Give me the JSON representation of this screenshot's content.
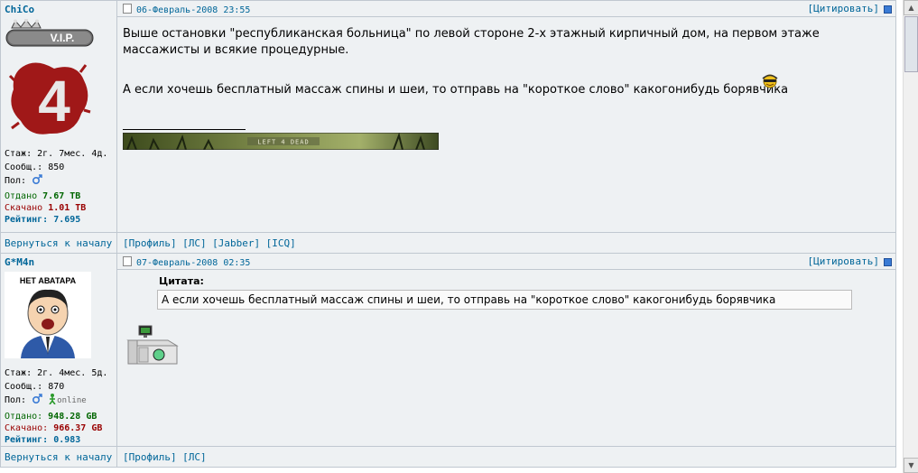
{
  "posts": [
    {
      "nick": "ChiCo",
      "rank_label": "V.I.P.",
      "avatar_label": "4",
      "stats": {
        "stage_label": "Стаж:",
        "stage": "2г. 7мес. 4д.",
        "posts_label": "Сообщ.:",
        "posts": "850",
        "gender_label": "Пол:",
        "up_label": "Отдано",
        "up": "7.67 TB",
        "down_label": "Скачано",
        "down": "1.01 TB",
        "rating_label": "Рейтинг",
        "rating": "7.695"
      },
      "date": "06-Февраль-2008 23:55",
      "quote_label": "[Цитировать]",
      "text1": "Выше остановки \"республиканская больница\" по левой стороне 2-х этажный кирпичный дом, на первом этаже массажисты и всякие процедурные.",
      "text2": "А если хочешь бесплатный массаж спины и шеи, то отправь на \"короткое слово\" какогонибудь борявчика",
      "banner_text": "LEFT 4 DEAD",
      "back_label": "Вернуться к началу",
      "links": [
        "[Профиль]",
        "[ЛС]",
        "[Jabber]",
        "[ICQ]"
      ]
    },
    {
      "nick": "G*M4n",
      "avatar_label": "НЕТ АВАТАРА",
      "stats": {
        "stage_label": "Стаж:",
        "stage": "2г. 4мес. 5д.",
        "posts_label": "Сообщ.:",
        "posts": "870",
        "gender_label": "Пол:",
        "online": "online",
        "up_label": "Отдано",
        "up": "948.28 GB",
        "down_label": "Скачано",
        "down": "966.37 GB",
        "rating_label": "Рейтинг",
        "rating": "0.983"
      },
      "date": "07-Февраль-2008 02:35",
      "quote_label": "[Цитировать]",
      "quote_title": "Цитата:",
      "quote_text": "А если хочешь бесплатный массаж спины и шеи, то отправь на \"короткое слово\" какогонибудь борявчика",
      "back_label": "Вернуться к началу",
      "links": [
        "[Профиль]",
        "[ЛС]"
      ]
    }
  ],
  "colors": {
    "link": "#006699",
    "up": "#006600",
    "down": "#990000",
    "panel": "#eef1f3"
  },
  "icons": [
    "document-icon",
    "male-icon",
    "online-icon",
    "smiley-icon",
    "computer-icon",
    "quote-square-icon"
  ]
}
